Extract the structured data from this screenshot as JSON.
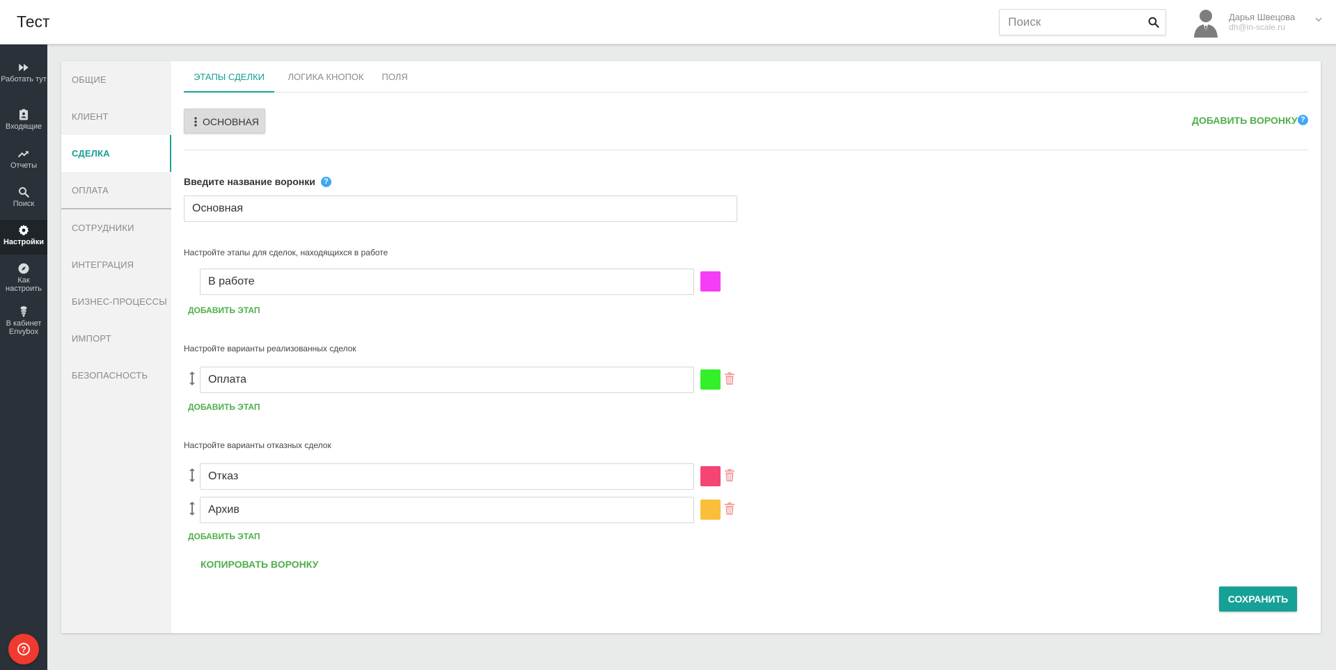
{
  "app": {
    "title": "Тест"
  },
  "search": {
    "placeholder": "Поиск"
  },
  "user": {
    "name": "Дарья Швецова",
    "email": "dh@in-scale.ru"
  },
  "leftnav": [
    {
      "label": "Работать тут",
      "icon": "fast-forward-icon"
    },
    {
      "label": "Входящие",
      "icon": "inbox-icon"
    },
    {
      "label": "Отчеты",
      "icon": "trending-up-icon"
    },
    {
      "label": "Поиск",
      "icon": "search-icon"
    },
    {
      "label": "Настройки",
      "icon": "gear-icon",
      "active": true
    },
    {
      "label": "Как настроить",
      "icon": "compass-icon"
    },
    {
      "label": "В кабинет Envybox",
      "icon": "envybox-icon"
    }
  ],
  "settings_menu": [
    {
      "label": "ОБЩИЕ"
    },
    {
      "label": "КЛИЕНТ"
    },
    {
      "label": "СДЕЛКА",
      "active": true
    },
    {
      "label": "ОПЛАТА"
    },
    {
      "label": "СОТРУДНИКИ"
    },
    {
      "label": "ИНТЕГРАЦИЯ"
    },
    {
      "label": "БИЗНЕС-ПРОЦЕССЫ"
    },
    {
      "label": "ИМПОРТ"
    },
    {
      "label": "БЕЗОПАСНОСТЬ"
    }
  ],
  "tabs": [
    {
      "label": "ЭТАПЫ СДЕЛКИ",
      "active": true
    },
    {
      "label": "ЛОГИКА КНОПОК"
    },
    {
      "label": "ПОЛЯ"
    }
  ],
  "funnel": {
    "chip_label": "ОСНОВНАЯ",
    "add_funnel_label": "ДОБАВИТЬ ВОРОНКУ",
    "name_label": "Введите название воронки",
    "name_value": "Основная"
  },
  "sections": {
    "in_work": {
      "label": "Настройте этапы для сделок, находящихся в работе",
      "stages": [
        {
          "name": "В работе",
          "color": "#f53df5"
        }
      ],
      "add_label": "ДОБАВИТЬ ЭТАП"
    },
    "success": {
      "label": "Настройте варианты реализованных сделок",
      "stages": [
        {
          "name": "Оплата",
          "color": "#33f02b"
        }
      ],
      "add_label": "ДОБАВИТЬ ЭТАП"
    },
    "failed": {
      "label": "Настройте варианты отказных сделок",
      "stages": [
        {
          "name": "Отказ",
          "color": "#f54572"
        },
        {
          "name": "Архив",
          "color": "#fbbe3b"
        }
      ],
      "add_label": "ДОБАВИТЬ ЭТАП"
    }
  },
  "actions": {
    "copy_funnel_label": "КОПИРОВАТЬ ВОРОНКУ",
    "save_label": "СОХРАНИТЬ"
  },
  "colors": {
    "accent": "#17a094",
    "green_link": "#4fae4b",
    "sidebar": "#2b3138",
    "help_button": "#f03a2f"
  }
}
